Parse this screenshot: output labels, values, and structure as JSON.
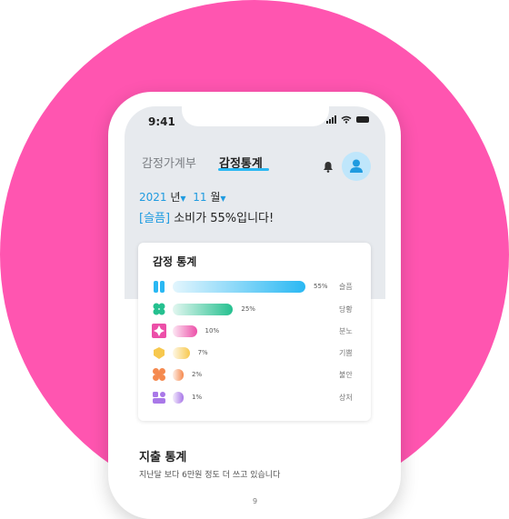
{
  "status": {
    "time": "9:41"
  },
  "tabs": [
    {
      "label": "감정가계부"
    },
    {
      "label": "감정통계"
    }
  ],
  "date": {
    "year": "2021",
    "year_unit": "년",
    "month": "11",
    "month_unit": "월"
  },
  "message": {
    "highlight": "[슬픔]",
    "text": " 소비가 55%입니다!"
  },
  "emotion_card": {
    "title": "감정 통계",
    "rows": [
      {
        "label": "슬픔",
        "percent_text": "55%",
        "percent": 55,
        "color": "#2ab8f3",
        "icon": "sad-emotion-icon"
      },
      {
        "label": "당황",
        "percent_text": "25%",
        "percent": 25,
        "color": "#25c08f",
        "icon": "embarrassed-emotion-icon"
      },
      {
        "label": "분노",
        "percent_text": "10%",
        "percent": 10,
        "color": "#ec4fa8",
        "icon": "anger-emotion-icon"
      },
      {
        "label": "기쁨",
        "percent_text": "7%",
        "percent": 7,
        "color": "#f7c84e",
        "icon": "joy-emotion-icon"
      },
      {
        "label": "불안",
        "percent_text": "2%",
        "percent": 2,
        "color": "#f5894e",
        "icon": "anxiety-emotion-icon"
      },
      {
        "label": "상처",
        "percent_text": "1%",
        "percent": 1,
        "color": "#a978e8",
        "icon": "hurt-emotion-icon"
      }
    ]
  },
  "spending": {
    "title": "지출 통계",
    "desc": "지난달 보다 6만원 정도 더 쓰고 있습니다"
  },
  "page_number": "9",
  "colors": {
    "background_blob": "#ff55b0",
    "accent": "#2ab8f3"
  }
}
